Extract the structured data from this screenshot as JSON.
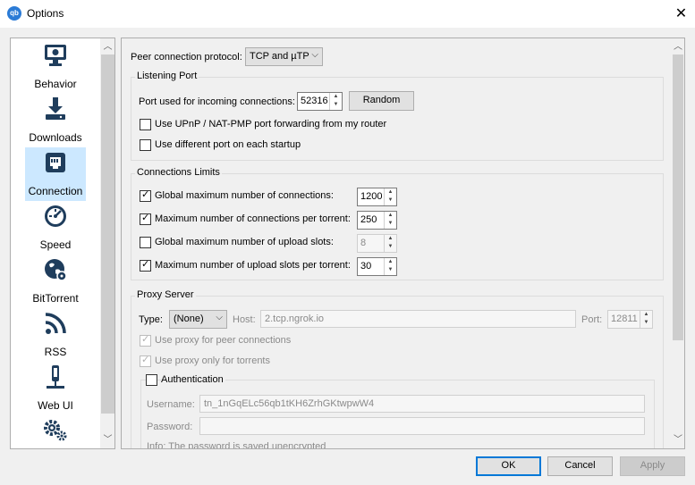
{
  "window": {
    "title": "Options",
    "app_icon_text": "qb",
    "close_glyph": "✕"
  },
  "sidebar": {
    "items": [
      {
        "label": "Behavior",
        "icon": "monitor-icon"
      },
      {
        "label": "Downloads",
        "icon": "download-icon"
      },
      {
        "label": "Connection",
        "icon": "network-icon",
        "selected": true
      },
      {
        "label": "Speed",
        "icon": "speedometer-icon"
      },
      {
        "label": "BitTorrent",
        "icon": "globe-icon"
      },
      {
        "label": "RSS",
        "icon": "rss-icon"
      },
      {
        "label": "Web UI",
        "icon": "webui-icon"
      },
      {
        "label": "",
        "icon": "gears-icon"
      }
    ]
  },
  "protocol": {
    "label": "Peer connection protocol:",
    "value": "TCP and µTP"
  },
  "listening": {
    "title": "Listening Port",
    "port_label": "Port used for incoming connections:",
    "port_value": "52316",
    "random_button": "Random",
    "upnp_label": "Use UPnP / NAT-PMP port forwarding from my router",
    "upnp_checked": false,
    "diffport_label": "Use different port on each startup",
    "diffport_checked": false
  },
  "limits": {
    "title": "Connections Limits",
    "rows": [
      {
        "label": "Global maximum number of connections:",
        "checked": true,
        "value": "1200",
        "enabled": true
      },
      {
        "label": "Maximum number of connections per torrent:",
        "checked": true,
        "value": "250",
        "enabled": true
      },
      {
        "label": "Global maximum number of upload slots:",
        "checked": false,
        "value": "8",
        "enabled": false
      },
      {
        "label": "Maximum number of upload slots per torrent:",
        "checked": true,
        "value": "30",
        "enabled": true
      }
    ]
  },
  "proxy": {
    "title": "Proxy Server",
    "type_label": "Type:",
    "type_value": "(None)",
    "host_label": "Host:",
    "host_value": "2.tcp.ngrok.io",
    "port_label": "Port:",
    "port_value": "12811",
    "peer_label": "Use proxy for peer connections",
    "torrents_label": "Use proxy only for torrents",
    "auth_label": "Authentication",
    "username_label": "Username:",
    "username_value": "tn_1nGqELc56qb1tKH6ZrhGKtwpwW4",
    "password_label": "Password:",
    "password_value": "",
    "info_text": "Info: The password is saved unencrypted"
  },
  "buttons": {
    "ok": "OK",
    "cancel": "Cancel",
    "apply": "Apply"
  },
  "colors": {
    "selection": "#cce8ff",
    "accent": "#0078d7",
    "icon": "#1f3d5c"
  }
}
